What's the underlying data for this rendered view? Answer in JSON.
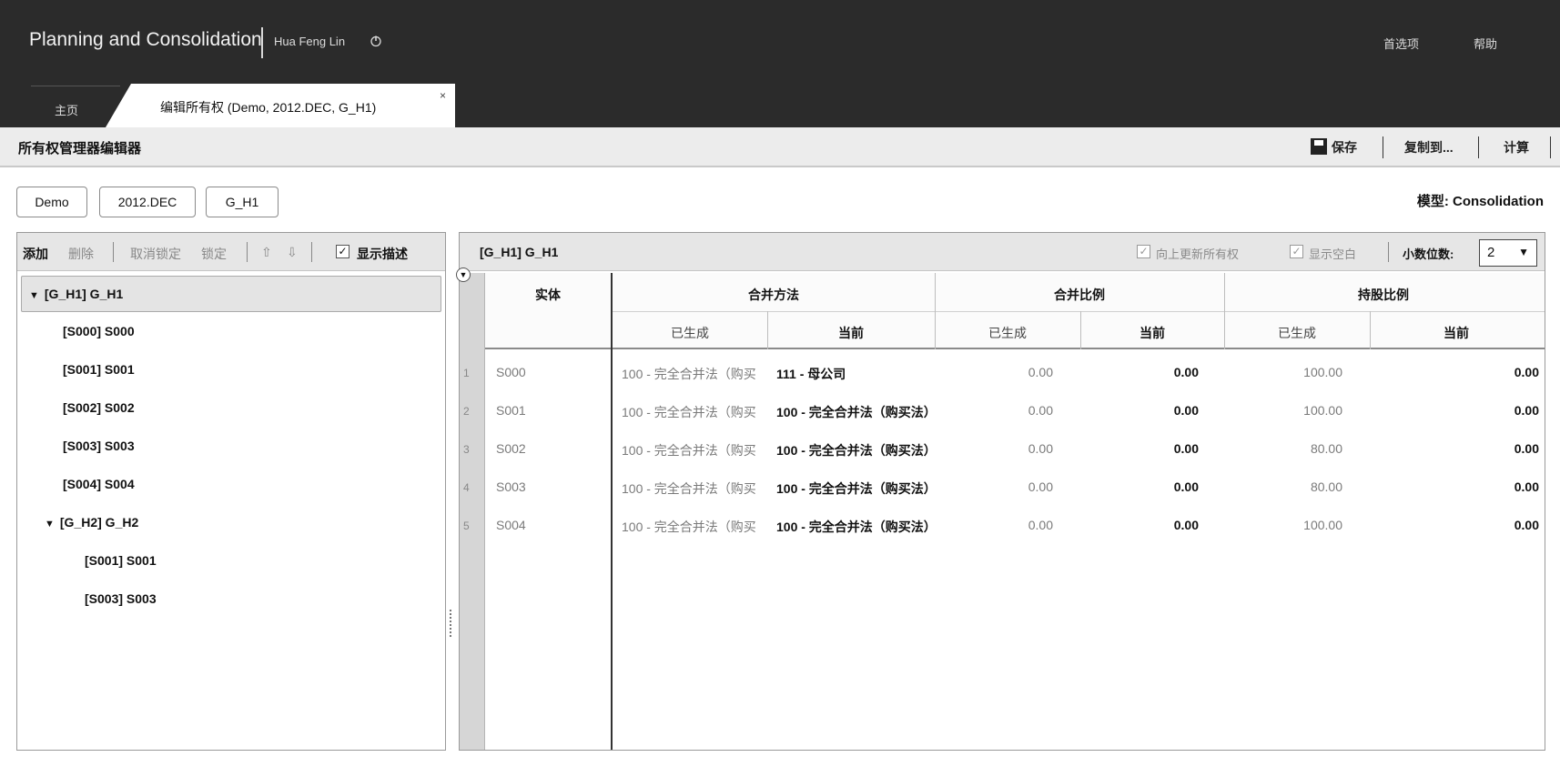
{
  "header": {
    "app_title": "Planning and Consolidation",
    "user_name": "Hua Feng Lin",
    "links": [
      "首选项",
      "帮助"
    ]
  },
  "tabs": [
    {
      "label": "主页"
    },
    {
      "label": "编辑所有权 (Demo, 2012.DEC, G_H1)",
      "close": "×"
    }
  ],
  "toolbar": {
    "title": "所有权管理器编辑器",
    "save": "保存",
    "copy_to": "复制到...",
    "calculate": "计算"
  },
  "context": {
    "pills": [
      "Demo",
      "2012.DEC",
      "G_H1"
    ],
    "model_label": "模型: Consolidation"
  },
  "left_toolbar": {
    "add": "添加",
    "delete": "删除",
    "unlock": "取消锁定",
    "lock": "锁定",
    "up": "⇧",
    "down": "⇩",
    "show_desc_check": "✓",
    "show_desc": "显示描述"
  },
  "tree": {
    "root": "[G_H1] G_H1",
    "items": [
      "[S000] S000",
      "[S001] S001",
      "[S002] S002",
      "[S003] S003",
      "[S004] S004"
    ],
    "sub_root": "[G_H2] G_H2",
    "sub_items": [
      "[S001] S001",
      "[S003] S003"
    ]
  },
  "grid": {
    "title": "[G_H1] G_H1",
    "options": {
      "update_up_check": "✓",
      "update_up": "向上更新所有权",
      "show_blank_check": "✓",
      "show_blank": "显示空白",
      "decimal_label": "小数位数:",
      "decimal_value": "2",
      "dropdown_arrow": "▼"
    },
    "headers": {
      "entity": "实体",
      "method": "合并方法",
      "pct_consol": "合并比例",
      "pct_own": "持股比例",
      "generated": "已生成",
      "current": "当前"
    },
    "rows": [
      {
        "n": "1",
        "entity": "S000",
        "method_gen": "100 - 完全合并法（购买",
        "method_cur": "111 - 母公司",
        "consol_gen": "0.00",
        "consol_cur": "0.00",
        "own_gen": "100.00",
        "own_cur": "0.00"
      },
      {
        "n": "2",
        "entity": "S001",
        "method_gen": "100 - 完全合并法（购买",
        "method_cur": "100 - 完全合并法（购买法）",
        "consol_gen": "0.00",
        "consol_cur": "0.00",
        "own_gen": "100.00",
        "own_cur": "0.00"
      },
      {
        "n": "3",
        "entity": "S002",
        "method_gen": "100 - 完全合并法（购买",
        "method_cur": "100 - 完全合并法（购买法）",
        "consol_gen": "0.00",
        "consol_cur": "0.00",
        "own_gen": "80.00",
        "own_cur": "0.00"
      },
      {
        "n": "4",
        "entity": "S003",
        "method_gen": "100 - 完全合并法（购买",
        "method_cur": "100 - 完全合并法（购买法）",
        "consol_gen": "0.00",
        "consol_cur": "0.00",
        "own_gen": "80.00",
        "own_cur": "0.00"
      },
      {
        "n": "5",
        "entity": "S004",
        "method_gen": "100 - 完全合并法（购买",
        "method_cur": "100 - 完全合并法（购买法）",
        "consol_gen": "0.00",
        "consol_cur": "0.00",
        "own_gen": "100.00",
        "own_cur": "0.00"
      }
    ]
  }
}
